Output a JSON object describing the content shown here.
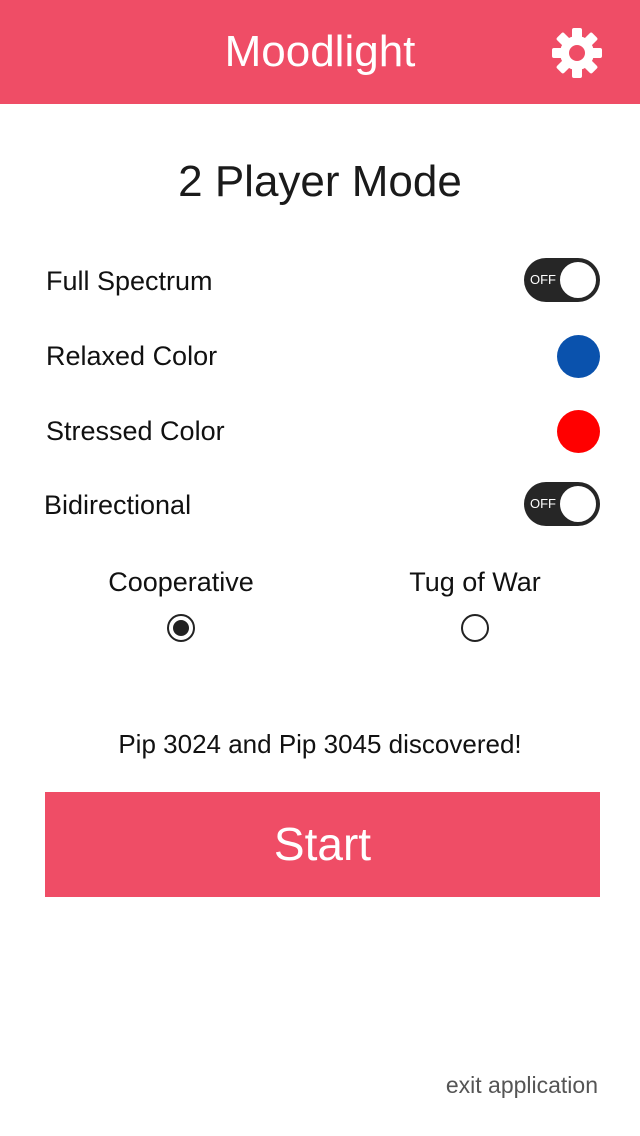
{
  "header": {
    "title": "Moodlight",
    "settings_icon": "gear-icon",
    "background_color": "#ef4d66"
  },
  "mode_title": "2 Player Mode",
  "settings": {
    "full_spectrum": {
      "label": "Full Spectrum",
      "toggle_state": "OFF"
    },
    "relaxed_color": {
      "label": "Relaxed Color",
      "color": "#0a52ad"
    },
    "stressed_color": {
      "label": "Stressed Color",
      "color": "#ff0000"
    },
    "bidirectional": {
      "label": "Bidirectional",
      "toggle_state": "OFF"
    }
  },
  "game_mode": {
    "options": [
      {
        "label": "Cooperative",
        "selected": true
      },
      {
        "label": "Tug of War",
        "selected": false
      }
    ]
  },
  "status": "Pip 3024  and Pip 3045 discovered!",
  "start_button": {
    "label": "Start",
    "color": "#ef4d66"
  },
  "exit_link": "exit application"
}
